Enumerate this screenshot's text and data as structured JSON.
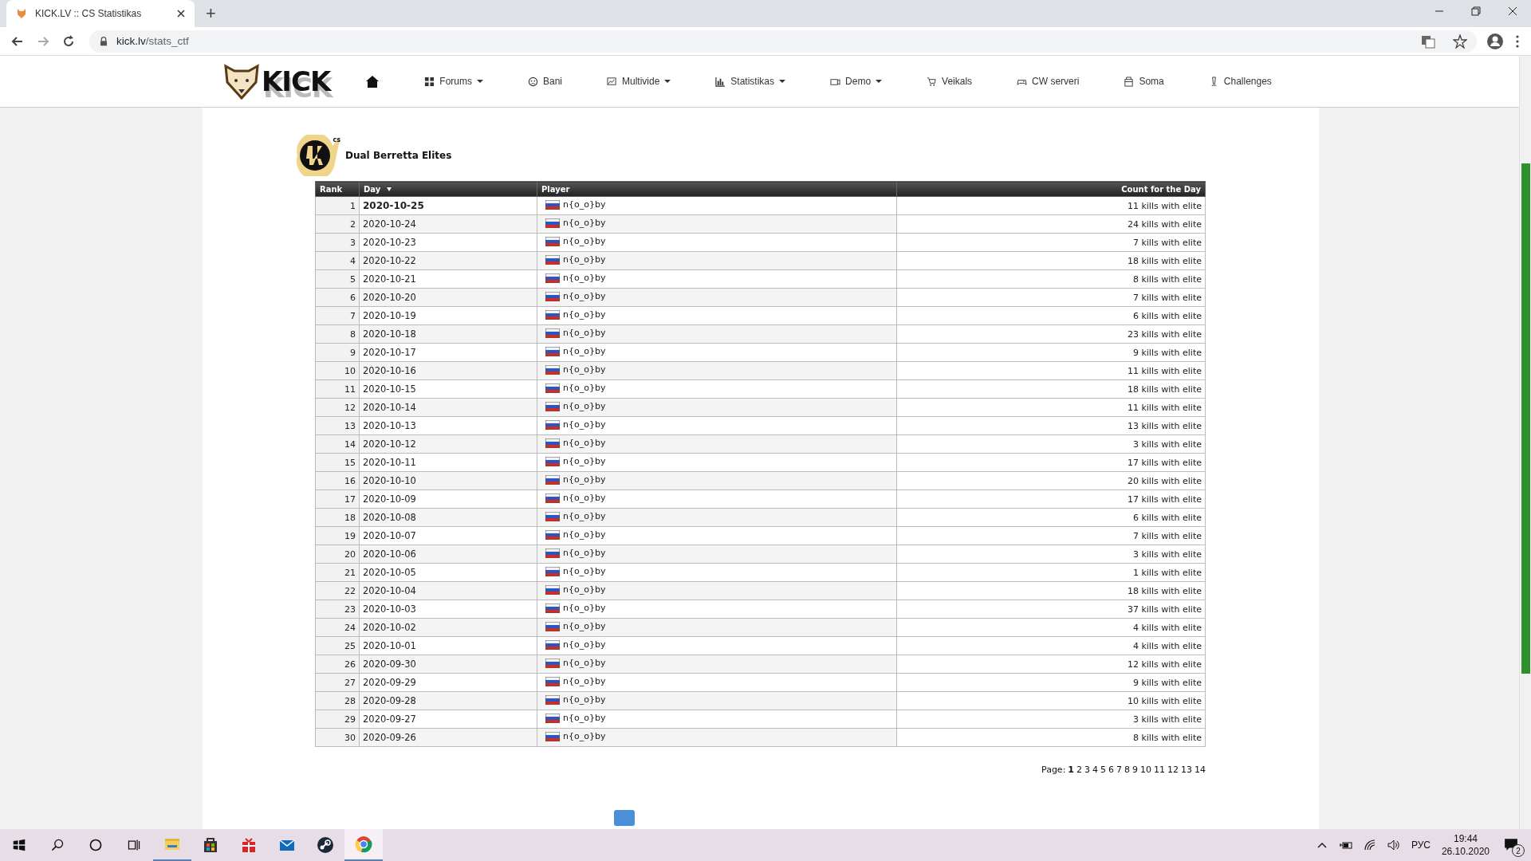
{
  "browser": {
    "tab_title": "KICK.LV :: CS Statistikas",
    "new_tab": "+",
    "url_host": "kick.lv",
    "url_path": "/stats_ctf"
  },
  "nav": {
    "logo": "KICK",
    "items": [
      {
        "label": "Forums",
        "dropdown": true
      },
      {
        "label": "Bani",
        "dropdown": false
      },
      {
        "label": "Multivide",
        "dropdown": true
      },
      {
        "label": "Statistikas",
        "dropdown": true
      },
      {
        "label": "Demo",
        "dropdown": true
      },
      {
        "label": "Veikals",
        "dropdown": false
      },
      {
        "label": "CW serveri",
        "dropdown": false
      },
      {
        "label": "Soma",
        "dropdown": false
      },
      {
        "label": "Challenges",
        "dropdown": false
      }
    ]
  },
  "weapon": {
    "title": "Dual Berretta Elites",
    "badge": "cs"
  },
  "table": {
    "columns": [
      {
        "label": "Rank",
        "sorted": false
      },
      {
        "label": "Day",
        "sorted": true
      },
      {
        "label": "Player",
        "sorted": false
      },
      {
        "label": "Count for the Day",
        "sorted": false
      }
    ],
    "rows": [
      {
        "rank": "1",
        "day": "2020-10-25",
        "player": "n{o_o}by",
        "count": "11 kills with elite",
        "current": true
      },
      {
        "rank": "2",
        "day": "2020-10-24",
        "player": "n{o_o}by",
        "count": "24 kills with elite",
        "current": false
      },
      {
        "rank": "3",
        "day": "2020-10-23",
        "player": "n{o_o}by",
        "count": "7 kills with elite",
        "current": false
      },
      {
        "rank": "4",
        "day": "2020-10-22",
        "player": "n{o_o}by",
        "count": "18 kills with elite",
        "current": false
      },
      {
        "rank": "5",
        "day": "2020-10-21",
        "player": "n{o_o}by",
        "count": "8 kills with elite",
        "current": false
      },
      {
        "rank": "6",
        "day": "2020-10-20",
        "player": "n{o_o}by",
        "count": "7 kills with elite",
        "current": false
      },
      {
        "rank": "7",
        "day": "2020-10-19",
        "player": "n{o_o}by",
        "count": "6 kills with elite",
        "current": false
      },
      {
        "rank": "8",
        "day": "2020-10-18",
        "player": "n{o_o}by",
        "count": "23 kills with elite",
        "current": false
      },
      {
        "rank": "9",
        "day": "2020-10-17",
        "player": "n{o_o}by",
        "count": "9 kills with elite",
        "current": false
      },
      {
        "rank": "10",
        "day": "2020-10-16",
        "player": "n{o_o}by",
        "count": "11 kills with elite",
        "current": false
      },
      {
        "rank": "11",
        "day": "2020-10-15",
        "player": "n{o_o}by",
        "count": "18 kills with elite",
        "current": false
      },
      {
        "rank": "12",
        "day": "2020-10-14",
        "player": "n{o_o}by",
        "count": "11 kills with elite",
        "current": false
      },
      {
        "rank": "13",
        "day": "2020-10-13",
        "player": "n{o_o}by",
        "count": "13 kills with elite",
        "current": false
      },
      {
        "rank": "14",
        "day": "2020-10-12",
        "player": "n{o_o}by",
        "count": "3 kills with elite",
        "current": false
      },
      {
        "rank": "15",
        "day": "2020-10-11",
        "player": "n{o_o}by",
        "count": "17 kills with elite",
        "current": false
      },
      {
        "rank": "16",
        "day": "2020-10-10",
        "player": "n{o_o}by",
        "count": "20 kills with elite",
        "current": false
      },
      {
        "rank": "17",
        "day": "2020-10-09",
        "player": "n{o_o}by",
        "count": "17 kills with elite",
        "current": false
      },
      {
        "rank": "18",
        "day": "2020-10-08",
        "player": "n{o_o}by",
        "count": "6 kills with elite",
        "current": false
      },
      {
        "rank": "19",
        "day": "2020-10-07",
        "player": "n{o_o}by",
        "count": "7 kills with elite",
        "current": false
      },
      {
        "rank": "20",
        "day": "2020-10-06",
        "player": "n{o_o}by",
        "count": "3 kills with elite",
        "current": false
      },
      {
        "rank": "21",
        "day": "2020-10-05",
        "player": "n{o_o}by",
        "count": "1 kills with elite",
        "current": false
      },
      {
        "rank": "22",
        "day": "2020-10-04",
        "player": "n{o_o}by",
        "count": "18 kills with elite",
        "current": false
      },
      {
        "rank": "23",
        "day": "2020-10-03",
        "player": "n{o_o}by",
        "count": "37 kills with elite",
        "current": false
      },
      {
        "rank": "24",
        "day": "2020-10-02",
        "player": "n{o_o}by",
        "count": "4 kills with elite",
        "current": false
      },
      {
        "rank": "25",
        "day": "2020-10-01",
        "player": "n{o_o}by",
        "count": "4 kills with elite",
        "current": false
      },
      {
        "rank": "26",
        "day": "2020-09-30",
        "player": "n{o_o}by",
        "count": "12 kills with elite",
        "current": false
      },
      {
        "rank": "27",
        "day": "2020-09-29",
        "player": "n{o_o}by",
        "count": "9 kills with elite",
        "current": false
      },
      {
        "rank": "28",
        "day": "2020-09-28",
        "player": "n{o_o}by",
        "count": "10 kills with elite",
        "current": false
      },
      {
        "rank": "29",
        "day": "2020-09-27",
        "player": "n{o_o}by",
        "count": "3 kills with elite",
        "current": false
      },
      {
        "rank": "30",
        "day": "2020-09-26",
        "player": "n{o_o}by",
        "count": "8 kills with elite",
        "current": false
      }
    ]
  },
  "pagination": {
    "label": "Page:",
    "pages": [
      {
        "label": "1",
        "selected": true
      },
      {
        "label": "2",
        "selected": false
      },
      {
        "label": "3",
        "selected": false
      },
      {
        "label": "4",
        "selected": false
      },
      {
        "label": "5",
        "selected": false
      },
      {
        "label": "6",
        "selected": false
      },
      {
        "label": "7",
        "selected": false
      },
      {
        "label": "8",
        "selected": false
      },
      {
        "label": "9",
        "selected": false
      },
      {
        "label": "10",
        "selected": false
      },
      {
        "label": "11",
        "selected": false
      },
      {
        "label": "12",
        "selected": false
      },
      {
        "label": "13",
        "selected": false
      },
      {
        "label": "14",
        "selected": false
      }
    ]
  },
  "taskbar": {
    "apps": [
      {
        "running": true,
        "active": false
      },
      {
        "running": false,
        "active": false
      },
      {
        "running": false,
        "active": false
      },
      {
        "running": false,
        "active": false
      },
      {
        "running": false,
        "active": false
      },
      {
        "running": true,
        "active": true
      }
    ],
    "language": "РУС",
    "time": "19:44",
    "date": "26.10.2020",
    "notifications": "2"
  }
}
